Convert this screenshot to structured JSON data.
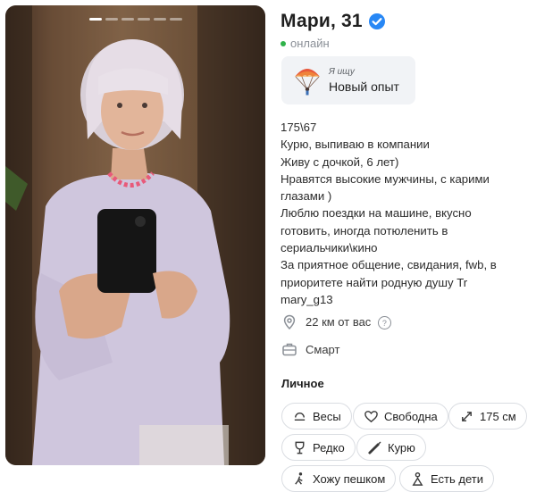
{
  "profile": {
    "name_age": "Мари, 31",
    "status": "онлайн",
    "seeking": {
      "label": "Я ищу",
      "value": "Новый опыт"
    },
    "bio_lines": [
      "175\\67",
      "Курю, выпиваю в компании",
      "Живу с дочкой, 6 лет)",
      "Нравятся высокие мужчины, с карими глазами )",
      "Люблю поездки на машине, вкусно готовить, иногда потюленить в сериальчики\\кино",
      "За приятное общение, свидания, fwb, в приоритете найти родную душу Tr",
      "mary_g13"
    ],
    "distance": "22 км от вас",
    "distance_help": "?",
    "occupation": "Смарт"
  },
  "personal": {
    "title": "Личное",
    "chips": [
      {
        "label": "Весы",
        "icon": "scales-icon"
      },
      {
        "label": "Свободна",
        "icon": "heart-icon"
      },
      {
        "label": "175 см",
        "icon": "height-arrows-icon"
      },
      {
        "label": "Редко",
        "icon": "wine-glass-icon"
      },
      {
        "label": "Курю",
        "icon": "cigarette-icon"
      },
      {
        "label": "Хожу пешком",
        "icon": "walking-icon"
      },
      {
        "label": "Есть дети",
        "icon": "child-icon"
      }
    ]
  },
  "gallery": {
    "photo_count": 6,
    "active_index": 0
  },
  "colors": {
    "accent": "#2787f5",
    "online": "#2fb24a",
    "chip_border": "#dadde2"
  }
}
